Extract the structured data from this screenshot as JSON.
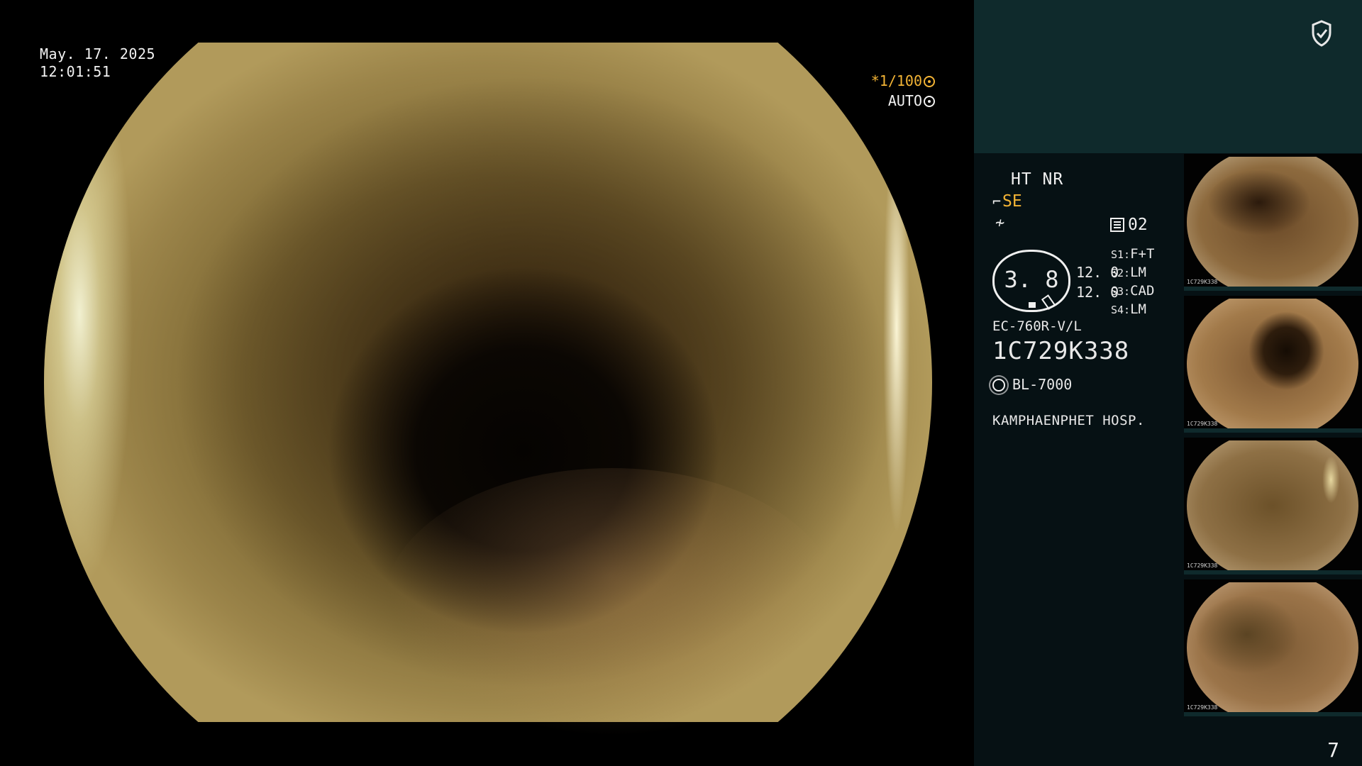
{
  "overlay": {
    "date": "May. 17. 2025",
    "time": "12:01:51",
    "shutter": "*1/100",
    "exposure_mode": "AUTO"
  },
  "panel": {
    "modes": "HT NR",
    "enhance": "SE",
    "memory": "02",
    "zoom": "3. 8",
    "values": [
      "12. 0",
      "12. 0"
    ],
    "settings": [
      {
        "key": "S1:",
        "value": "F+T"
      },
      {
        "key": "S2:",
        "value": "LM"
      },
      {
        "key": "S3:",
        "value": "CAD"
      },
      {
        "key": "S4:",
        "value": "LM"
      }
    ],
    "scope_model": "EC-760R-V/L",
    "serial": "1C729K338",
    "light_source": "BL-7000",
    "hospital": "KAMPHAENPHET HOSP.",
    "page_number": "7"
  },
  "thumbnails": [
    {
      "caption": "1C729K338"
    },
    {
      "caption": "1C729K338"
    },
    {
      "caption": "1C729K338"
    },
    {
      "caption": "1C729K338"
    }
  ],
  "icons": {
    "header": "shield-check-icon",
    "shutter": "aperture-icon",
    "auto": "auto-exposure-icon",
    "lamp": "sun-icon",
    "memory": "memory-icon"
  },
  "colors": {
    "accent": "#f3b435",
    "panel_bg": "#061114",
    "header_bg": "#0f2a2c"
  }
}
